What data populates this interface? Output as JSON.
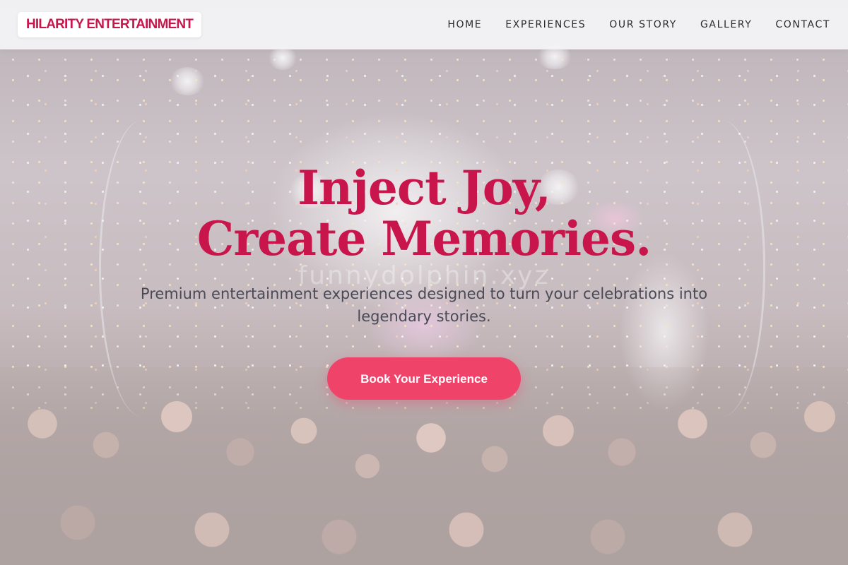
{
  "header": {
    "logo_text": "HILARITY ENTERTAINMENT",
    "nav": [
      {
        "label": "HOME"
      },
      {
        "label": "EXPERIENCES"
      },
      {
        "label": "OUR STORY"
      },
      {
        "label": "GALLERY"
      },
      {
        "label": "CONTACT"
      }
    ]
  },
  "hero": {
    "title_line1": "Inject Joy,",
    "title_line2": "Create Memories.",
    "watermark": "funnydolphin.xyz",
    "subtitle": "Premium entertainment experiences designed to turn your celebrations into legendary stories.",
    "cta_label": "Book Your Experience"
  },
  "colors": {
    "brand": "#c8164d",
    "cta": "#f0436a",
    "nav_text": "#2b2b2b"
  }
}
